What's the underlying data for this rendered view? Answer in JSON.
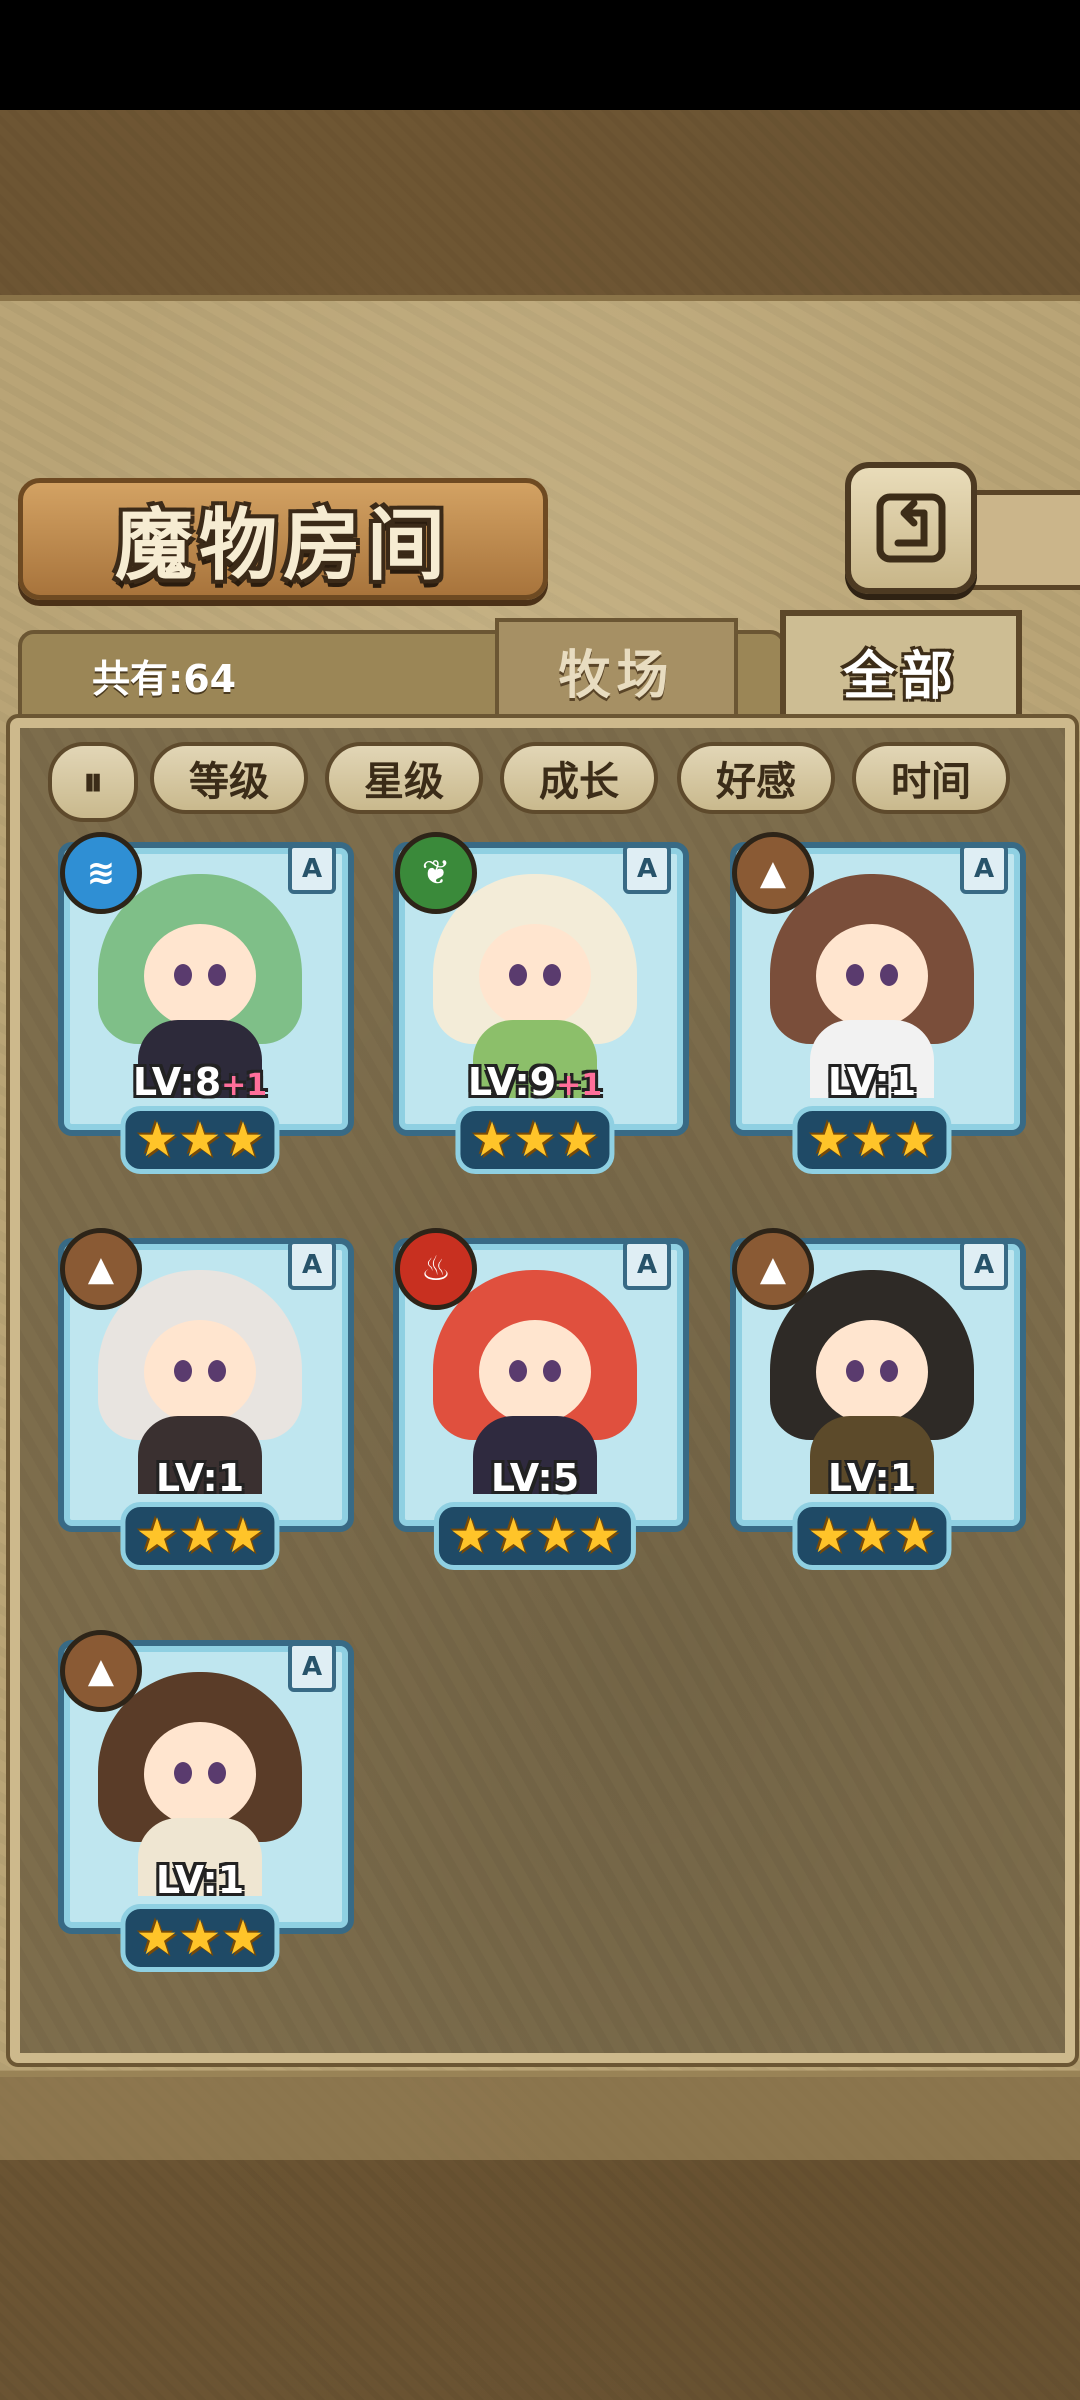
{
  "title": "魔物房间",
  "count_label": "共有:64",
  "tabs": [
    {
      "label": "牧场",
      "active": false
    },
    {
      "label": "全部",
      "active": true
    }
  ],
  "sort_buttons": [
    "等级",
    "星级",
    "成长",
    "好感",
    "时间"
  ],
  "monsters": [
    {
      "element": "water-icon",
      "element_color": "#2f8fd4",
      "rank": "A",
      "level": "LV:8",
      "bonus": "+1",
      "stars": 3,
      "hair": "#7fbf88",
      "body": "#2d2a3a"
    },
    {
      "element": "leaf-icon",
      "element_color": "#3a8a3a",
      "rank": "A",
      "level": "LV:9",
      "bonus": "+1",
      "stars": 3,
      "hair": "#f3ecd8",
      "body": "#8cbf6a"
    },
    {
      "element": "mountain-icon",
      "element_color": "#8a5a34",
      "rank": "A",
      "level": "LV:1",
      "bonus": "",
      "stars": 3,
      "hair": "#7a4e3a",
      "body": "#f2f2f2"
    },
    {
      "element": "mountain-icon",
      "element_color": "#8a5a34",
      "rank": "A",
      "level": "LV:1",
      "bonus": "",
      "stars": 3,
      "hair": "#e8e4e0",
      "body": "#3a3030"
    },
    {
      "element": "fire-icon",
      "element_color": "#c83020",
      "rank": "A",
      "level": "LV:5",
      "bonus": "",
      "stars": 4,
      "hair": "#e0503e",
      "body": "#2f2a3f"
    },
    {
      "element": "mountain-icon",
      "element_color": "#8a5a34",
      "rank": "A",
      "level": "LV:1",
      "bonus": "",
      "stars": 3,
      "hair": "#2e2a26",
      "body": "#5c4a2a"
    },
    {
      "element": "mountain-icon",
      "element_color": "#8a5a34",
      "rank": "A",
      "level": "LV:1",
      "bonus": "",
      "stars": 3,
      "hair": "#5a3c28",
      "body": "#efe6d2"
    }
  ]
}
